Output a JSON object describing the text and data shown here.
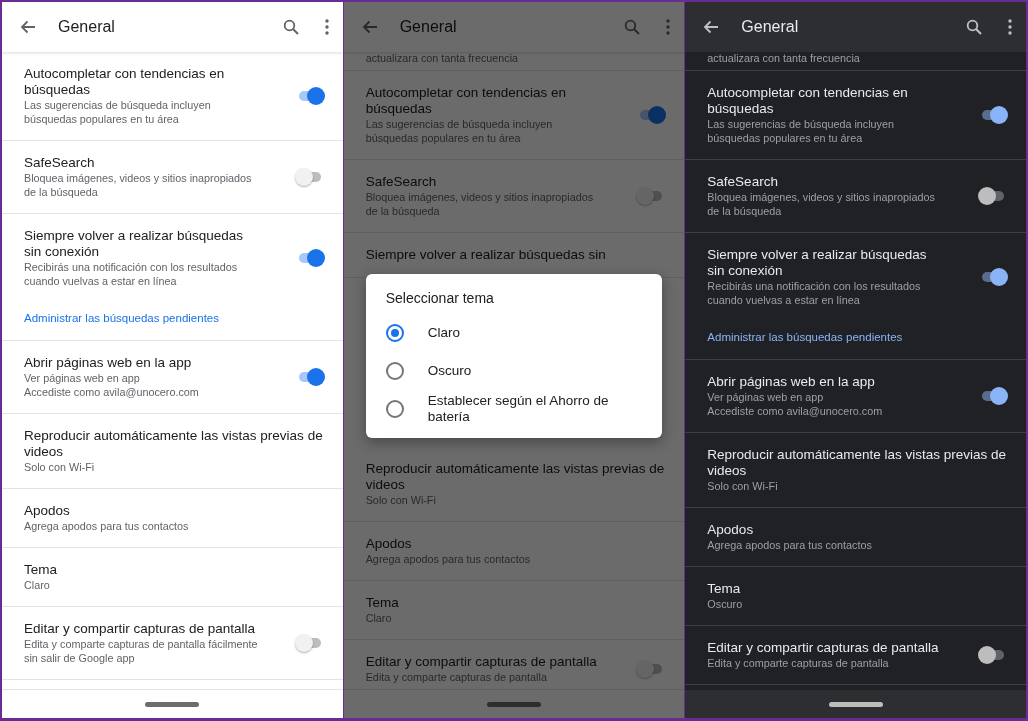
{
  "panels": [
    {
      "kind": "light",
      "header": {
        "title": "General"
      },
      "items": [
        {
          "kind": "setting",
          "title": "Autocompletar con tendencias en búsquedas",
          "subtitle": [
            "Las sugerencias de búsqueda incluyen búsquedas populares en tu área"
          ],
          "on": true
        },
        {
          "kind": "setting",
          "title": "SafeSearch",
          "subtitle": [
            "Bloquea imágenes, videos y sitios inapropiados de la búsqueda"
          ],
          "on": false
        },
        {
          "kind": "setting",
          "title": "Siempre volver a realizar búsquedas sin conexión",
          "subtitle": [
            "Recibirás una notificación con los resultados cuando vuelvas a estar en línea"
          ],
          "on": true,
          "link": "Administrar las búsquedas pendientes"
        },
        {
          "kind": "setting",
          "title": "Abrir páginas web en la app",
          "subtitle": [
            "Ver páginas web en app",
            "Accediste como avila@unocero.com"
          ],
          "on": true
        },
        {
          "kind": "setting",
          "title": "Reproducir automáticamente las vistas previas de videos",
          "subtitle": [
            "Solo con Wi-Fi"
          ]
        },
        {
          "kind": "setting",
          "title": "Apodos",
          "subtitle": [
            "Agrega apodos para tus contactos"
          ]
        },
        {
          "kind": "setting",
          "title": "Tema",
          "subtitle": [
            "Claro"
          ]
        },
        {
          "kind": "setting",
          "title": "Editar y compartir capturas de pantalla",
          "subtitle": [
            "Edita y comparte capturas de pantalla fácilmente sin salir de Google app"
          ],
          "on": false
        }
      ]
    },
    {
      "kind": "light",
      "header": {
        "title": "General"
      },
      "top_fragment": "actualizara con tanta frecuencia",
      "items": [
        {
          "kind": "setting",
          "title": "Autocompletar con tendencias en búsquedas",
          "subtitle": [
            "Las sugerencias de búsqueda incluyen búsquedas populares en tu área"
          ],
          "on": true
        },
        {
          "kind": "setting",
          "title": "SafeSearch",
          "subtitle": [
            "Bloquea imágenes, videos y sitios inapropiados de la búsqueda"
          ],
          "on": false
        },
        {
          "kind": "setting",
          "title": "Siempre volver a realizar búsquedas sin"
        },
        {
          "kind": "dialog",
          "title": "Seleccionar tema",
          "options": [
            {
              "label": "Claro",
              "selected": true
            },
            {
              "label": "Oscuro",
              "selected": false
            },
            {
              "label": "Establecer según el Ahorro de batería",
              "selected": false
            }
          ]
        },
        {
          "kind": "setting",
          "title": "Reproducir automáticamente las vistas previas de videos",
          "subtitle": [
            "Solo con Wi-Fi"
          ]
        },
        {
          "kind": "setting",
          "title": "Apodos",
          "subtitle": [
            "Agrega apodos para tus contactos"
          ]
        },
        {
          "kind": "setting",
          "title": "Tema",
          "subtitle": [
            "Claro"
          ]
        },
        {
          "kind": "setting",
          "title": "Editar y compartir capturas de pantalla",
          "subtitle": [
            "Edita y comparte capturas de pantalla"
          ],
          "on": false
        }
      ]
    },
    {
      "kind": "dark",
      "header": {
        "title": "General"
      },
      "top_fragment": "actualizara con tanta frecuencia",
      "items": [
        {
          "kind": "setting",
          "title": "Autocompletar con tendencias en búsquedas",
          "subtitle": [
            "Las sugerencias de búsqueda incluyen búsquedas populares en tu área"
          ],
          "on": true
        },
        {
          "kind": "setting",
          "title": "SafeSearch",
          "subtitle": [
            "Bloquea imágenes, videos y sitios inapropiados de la búsqueda"
          ],
          "on": false
        },
        {
          "kind": "setting",
          "title": "Siempre volver a realizar búsquedas sin conexión",
          "subtitle": [
            "Recibirás una notificación con los resultados cuando vuelvas a estar en línea"
          ],
          "on": true,
          "link": "Administrar las búsquedas pendientes"
        },
        {
          "kind": "setting",
          "title": "Abrir páginas web en la app",
          "subtitle": [
            "Ver páginas web en app",
            "Accediste como avila@unocero.com"
          ],
          "on": true
        },
        {
          "kind": "setting",
          "title": "Reproducir automáticamente las vistas previas de videos",
          "subtitle": [
            "Solo con Wi-Fi"
          ]
        },
        {
          "kind": "setting",
          "title": "Apodos",
          "subtitle": [
            "Agrega apodos para tus contactos"
          ]
        },
        {
          "kind": "setting",
          "title": "Tema",
          "subtitle": [
            "Oscuro"
          ]
        },
        {
          "kind": "setting",
          "title": "Editar y compartir capturas de pantalla",
          "subtitle": [
            "Edita y comparte capturas de pantalla"
          ],
          "on": false
        }
      ]
    }
  ]
}
